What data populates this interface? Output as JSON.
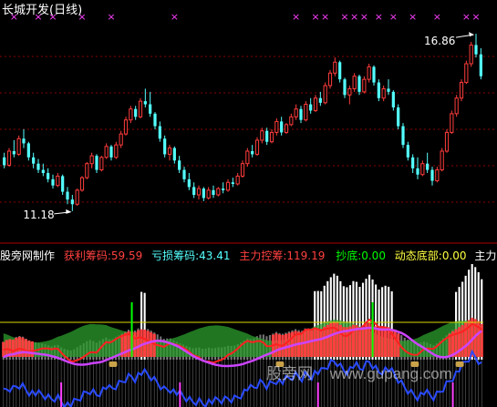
{
  "window": {
    "title": "长城开发(日线)"
  },
  "colors": {
    "background": "#000000",
    "up": "#ff3c3c",
    "down": "#54ffff",
    "grid": "#8a0000",
    "marker": "#ff40ff",
    "annotation": "#ffffff",
    "profit": "#ff4040",
    "loss": "#54ffff",
    "control": "#ff4040",
    "bottom_signal": "#00ff00",
    "dynamic_bottom": "#ffff40",
    "main_chip": "#ffffff",
    "main_line": "#ff2020",
    "purple_line": "#cc44ff",
    "blue_line": "#2a4bff",
    "yellow_line": "#d8d800",
    "green_area": "#2c9d2c",
    "gray_bar": "#9a9a9a",
    "white_bar": "#ffffff"
  },
  "chart_data": [
    {
      "type": "candlestick",
      "title": "长城开发(日线)",
      "ylim": [
        10.3,
        17.3
      ],
      "annotations": [
        {
          "text": "16.86",
          "value": 16.86,
          "kind": "high"
        },
        {
          "text": "11.18",
          "value": 11.18,
          "kind": "low"
        }
      ],
      "marker_row": "top signal markers (×)",
      "ohlc": [
        [
          12.9,
          13.05,
          12.55,
          12.65
        ],
        [
          12.65,
          13.2,
          12.6,
          13.1
        ],
        [
          13.1,
          13.45,
          12.9,
          13.0
        ],
        [
          13.0,
          13.6,
          12.95,
          13.5
        ],
        [
          13.5,
          13.8,
          13.2,
          13.35
        ],
        [
          13.35,
          13.4,
          12.8,
          12.9
        ],
        [
          12.9,
          13.05,
          12.55,
          12.7
        ],
        [
          12.7,
          12.85,
          12.4,
          12.5
        ],
        [
          12.5,
          12.7,
          12.3,
          12.4
        ],
        [
          12.4,
          12.55,
          12.1,
          12.2
        ],
        [
          12.2,
          12.35,
          11.9,
          12.0
        ],
        [
          12.0,
          12.4,
          11.95,
          12.3
        ],
        [
          12.3,
          12.35,
          11.7,
          11.8
        ],
        [
          11.8,
          11.95,
          11.4,
          11.55
        ],
        [
          11.55,
          11.7,
          11.18,
          11.4
        ],
        [
          11.4,
          11.9,
          11.35,
          11.85
        ],
        [
          11.85,
          12.3,
          11.8,
          12.25
        ],
        [
          12.25,
          12.75,
          12.2,
          12.7
        ],
        [
          12.7,
          13.05,
          12.55,
          12.95
        ],
        [
          12.95,
          13.0,
          12.4,
          12.5
        ],
        [
          12.5,
          12.95,
          12.45,
          12.9
        ],
        [
          12.9,
          13.35,
          12.85,
          13.25
        ],
        [
          13.25,
          13.3,
          12.8,
          12.9
        ],
        [
          12.9,
          13.4,
          12.85,
          13.3
        ],
        [
          13.3,
          13.75,
          13.2,
          13.65
        ],
        [
          13.65,
          14.2,
          13.6,
          14.1
        ],
        [
          14.1,
          14.55,
          14.0,
          14.45
        ],
        [
          14.45,
          14.55,
          14.1,
          14.2
        ],
        [
          14.2,
          14.8,
          14.15,
          14.7
        ],
        [
          14.7,
          15.1,
          14.5,
          14.6
        ],
        [
          14.6,
          15.0,
          14.2,
          14.3
        ],
        [
          14.3,
          14.35,
          13.8,
          13.9
        ],
        [
          13.9,
          14.05,
          13.4,
          13.5
        ],
        [
          13.5,
          13.6,
          12.9,
          13.0
        ],
        [
          13.0,
          13.3,
          12.8,
          13.2
        ],
        [
          13.2,
          13.25,
          12.7,
          12.8
        ],
        [
          12.8,
          12.95,
          12.4,
          12.5
        ],
        [
          12.5,
          12.6,
          12.1,
          12.2
        ],
        [
          12.2,
          12.4,
          11.85,
          11.95
        ],
        [
          11.95,
          12.1,
          11.6,
          11.7
        ],
        [
          11.7,
          12.0,
          11.55,
          11.9
        ],
        [
          11.9,
          11.95,
          11.5,
          11.6
        ],
        [
          11.6,
          11.95,
          11.55,
          11.85
        ],
        [
          11.85,
          12.0,
          11.6,
          11.7
        ],
        [
          11.7,
          11.95,
          11.65,
          11.9
        ],
        [
          11.9,
          12.1,
          11.75,
          11.85
        ],
        [
          11.85,
          12.2,
          11.8,
          12.1
        ],
        [
          12.1,
          12.25,
          11.95,
          12.05
        ],
        [
          12.05,
          12.4,
          12.0,
          12.3
        ],
        [
          12.3,
          12.8,
          12.25,
          12.7
        ],
        [
          12.7,
          13.2,
          12.6,
          13.1
        ],
        [
          13.1,
          13.3,
          12.9,
          13.0
        ],
        [
          13.0,
          13.55,
          12.95,
          13.45
        ],
        [
          13.45,
          13.85,
          13.35,
          13.75
        ],
        [
          13.75,
          13.85,
          13.3,
          13.4
        ],
        [
          13.4,
          13.8,
          13.35,
          13.7
        ],
        [
          13.7,
          14.15,
          13.6,
          14.05
        ],
        [
          14.05,
          14.2,
          13.6,
          13.7
        ],
        [
          13.7,
          14.0,
          13.65,
          13.95
        ],
        [
          13.95,
          14.3,
          13.9,
          14.2
        ],
        [
          14.2,
          14.6,
          14.1,
          14.45
        ],
        [
          14.45,
          14.55,
          14.0,
          14.1
        ],
        [
          14.1,
          14.7,
          14.05,
          14.6
        ],
        [
          14.6,
          14.8,
          14.3,
          14.4
        ],
        [
          14.4,
          14.9,
          14.35,
          14.8
        ],
        [
          14.8,
          15.0,
          14.55,
          14.65
        ],
        [
          14.65,
          15.3,
          14.6,
          15.2
        ],
        [
          15.2,
          15.7,
          15.1,
          15.6
        ],
        [
          15.6,
          16.1,
          15.5,
          15.95
        ],
        [
          15.95,
          16.0,
          15.3,
          15.4
        ],
        [
          15.4,
          15.45,
          14.8,
          14.9
        ],
        [
          14.9,
          15.2,
          14.6,
          15.1
        ],
        [
          15.1,
          15.6,
          15.0,
          15.5
        ],
        [
          15.5,
          15.55,
          14.9,
          15.0
        ],
        [
          15.0,
          15.5,
          14.95,
          15.4
        ],
        [
          15.4,
          15.9,
          15.3,
          15.8
        ],
        [
          15.8,
          15.85,
          15.2,
          15.3
        ],
        [
          15.3,
          15.4,
          14.7,
          14.8
        ],
        [
          14.8,
          15.2,
          14.7,
          15.1
        ],
        [
          15.1,
          15.4,
          14.9,
          15.0
        ],
        [
          15.0,
          15.05,
          14.4,
          14.5
        ],
        [
          14.5,
          14.6,
          13.8,
          13.9
        ],
        [
          13.9,
          14.0,
          13.2,
          13.3
        ],
        [
          13.3,
          13.4,
          12.8,
          12.9
        ],
        [
          12.9,
          13.0,
          12.4,
          12.55
        ],
        [
          12.55,
          12.9,
          12.2,
          12.35
        ],
        [
          12.35,
          12.8,
          12.3,
          12.7
        ],
        [
          12.7,
          13.05,
          12.4,
          12.5
        ],
        [
          12.5,
          12.6,
          12.0,
          12.15
        ],
        [
          12.15,
          12.6,
          12.1,
          12.5
        ],
        [
          12.5,
          13.2,
          12.45,
          13.1
        ],
        [
          13.1,
          13.8,
          13.05,
          13.7
        ],
        [
          13.7,
          14.4,
          13.65,
          14.3
        ],
        [
          14.3,
          14.9,
          14.2,
          14.8
        ],
        [
          14.8,
          15.4,
          14.7,
          15.3
        ],
        [
          15.3,
          16.0,
          15.25,
          15.9
        ],
        [
          15.9,
          16.6,
          15.8,
          16.5
        ],
        [
          16.5,
          16.86,
          16.1,
          16.2
        ],
        [
          16.2,
          16.4,
          15.4,
          15.5
        ]
      ]
    },
    {
      "type": "indicator",
      "series": [
        {
          "name": "获利筹码",
          "value_text": "59.59"
        },
        {
          "name": "亏损筹码",
          "value_text": "43.41"
        },
        {
          "name": "主力控筹",
          "value_text": "119.19"
        },
        {
          "name": "抄底",
          "value_text": "0.00"
        },
        {
          "name": "动态底部",
          "value_text": "0.00"
        },
        {
          "name": "主力筹"
        }
      ]
    }
  ],
  "legend": {
    "source": "股旁网制作",
    "items": [
      {
        "label": "获利筹码:59.59"
      },
      {
        "label": "亏损筹码:43.41"
      },
      {
        "label": "主力控筹:119.19"
      },
      {
        "label": "抄底:0.00"
      },
      {
        "label": "动态底部:0.00"
      },
      {
        "label": "主力筹"
      }
    ]
  },
  "watermark": {
    "left": "股旁网",
    "right": "www.gupang.com"
  }
}
